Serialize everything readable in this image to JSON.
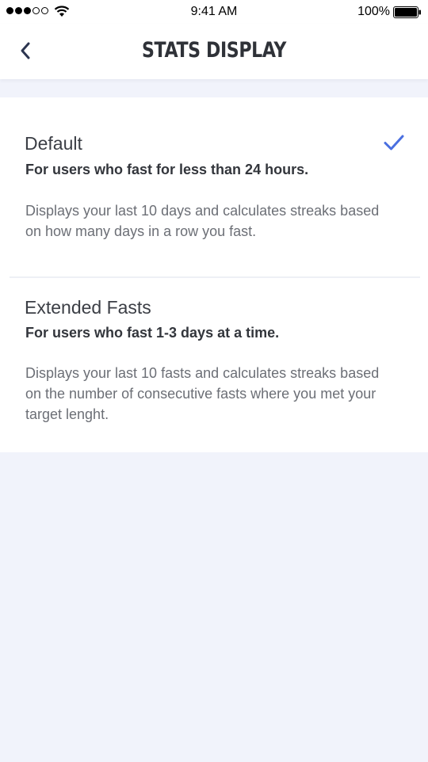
{
  "status_bar": {
    "time": "9:41 AM",
    "battery": "100%",
    "signal_icon": "signal-dots-icon",
    "wifi_icon": "wifi-icon",
    "battery_icon": "battery-icon"
  },
  "nav": {
    "title": "STATS DISPLAY",
    "back_icon": "chevron-left-icon"
  },
  "options": [
    {
      "title": "Default",
      "subtitle": "For users who fast for less than 24 hours.",
      "description": "Displays your last 10 days and calculates streaks based on how many days in a row you fast.",
      "selected": true
    },
    {
      "title": "Extended Fasts",
      "subtitle": "For users who fast 1-3 days at a time.",
      "description": "Displays your last 10 fasts and calculates streaks based on the number of consecutive fasts where you met your target lenght.",
      "selected": false
    }
  ],
  "colors": {
    "accent": "#4a6fe0",
    "background": "#f1f3fb",
    "card": "#ffffff"
  }
}
